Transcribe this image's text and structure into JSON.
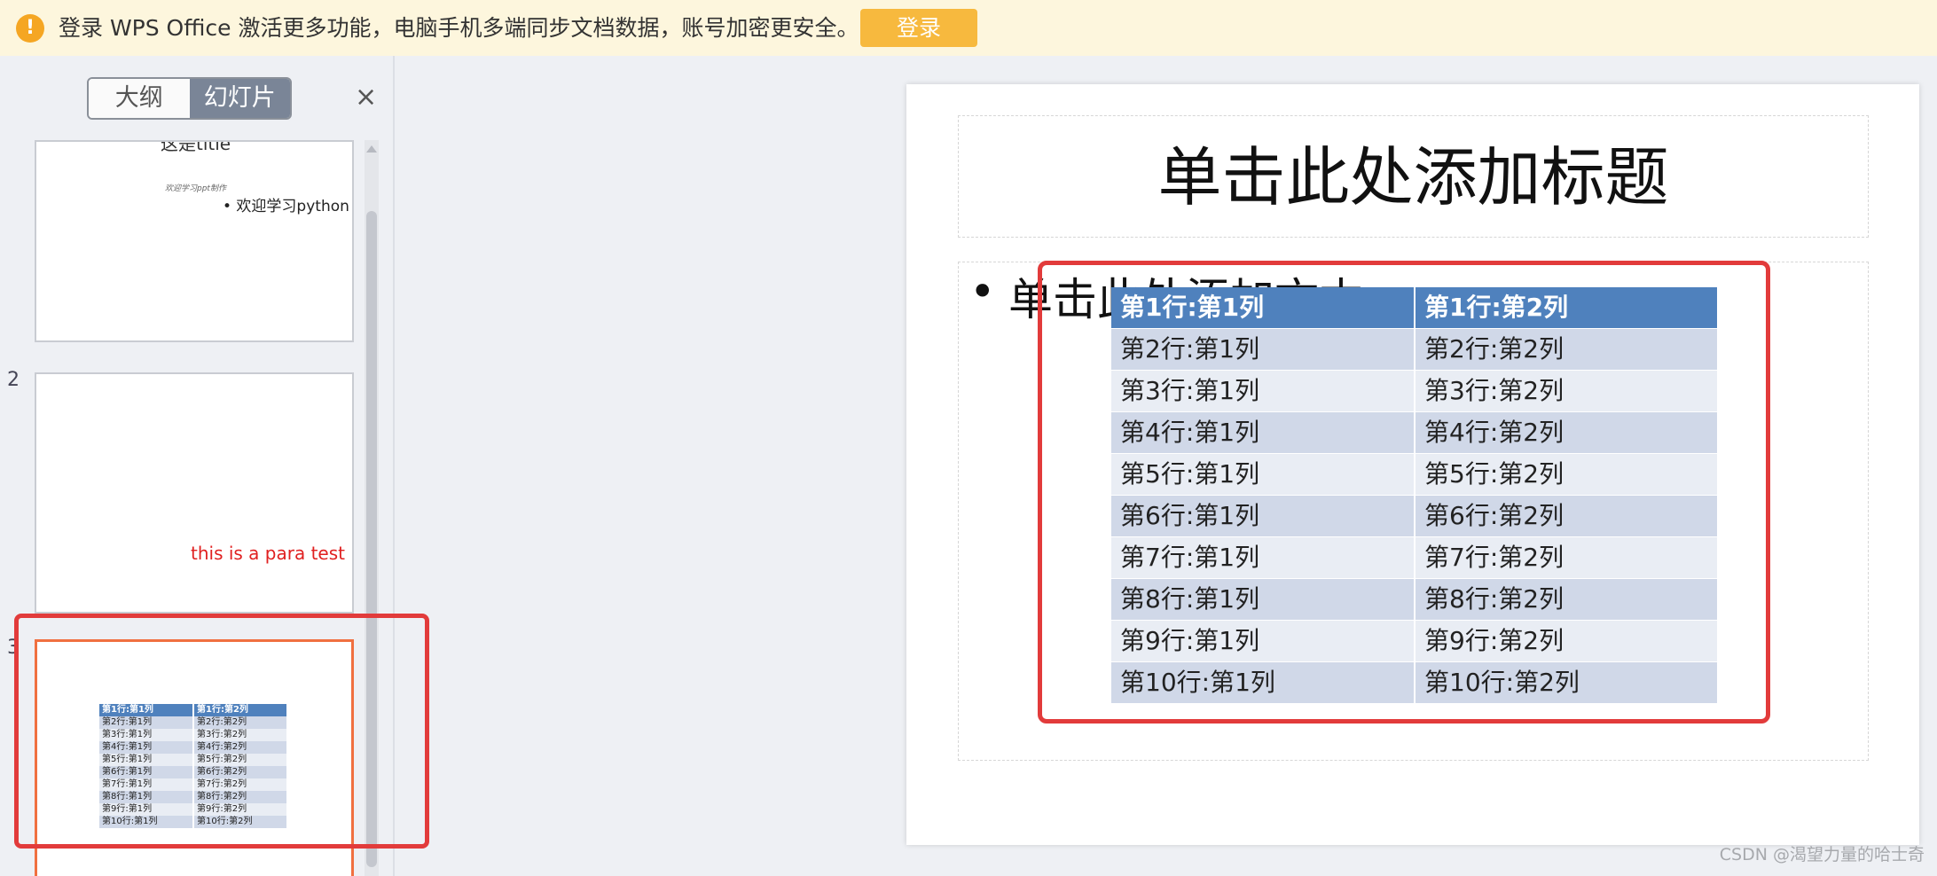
{
  "banner": {
    "icon": "warning-icon",
    "text": "登录 WPS Office 激活更多功能，电脑手机多端同步文档数据，账号加密更安全。",
    "login_label": "登录"
  },
  "sidebar": {
    "tabs": [
      "大纲",
      "幻灯片"
    ],
    "active_tab": "幻灯片",
    "close_icon": "close-icon",
    "thumbnails": [
      {
        "number": "",
        "title": "这是title",
        "small_text": "欢迎学习ppt制作",
        "bullet": "• 欢迎学习python"
      },
      {
        "number": "2",
        "para": "this is a para test"
      },
      {
        "number": "3",
        "rows": [
          [
            "第1行:第1列",
            "第1行:第2列"
          ],
          [
            "第2行:第1列",
            "第2行:第2列"
          ],
          [
            "第3行:第1列",
            "第3行:第2列"
          ],
          [
            "第4行:第1列",
            "第4行:第2列"
          ],
          [
            "第5行:第1列",
            "第5行:第2列"
          ],
          [
            "第6行:第1列",
            "第6行:第2列"
          ],
          [
            "第7行:第1列",
            "第7行:第2列"
          ],
          [
            "第8行:第1列",
            "第8行:第2列"
          ],
          [
            "第9行:第1列",
            "第9行:第2列"
          ],
          [
            "第10行:第1列",
            "第10行:第2列"
          ]
        ]
      }
    ]
  },
  "slide": {
    "title": "单击此处添加标题",
    "bullet": "•",
    "body_text": "单击此处添加文本",
    "table": [
      [
        "第1行:第1列",
        "第1行:第2列"
      ],
      [
        "第2行:第1列",
        "第2行:第2列"
      ],
      [
        "第3行:第1列",
        "第3行:第2列"
      ],
      [
        "第4行:第1列",
        "第4行:第2列"
      ],
      [
        "第5行:第1列",
        "第5行:第2列"
      ],
      [
        "第6行:第1列",
        "第6行:第2列"
      ],
      [
        "第7行:第1列",
        "第7行:第2列"
      ],
      [
        "第8行:第1列",
        "第8行:第2列"
      ],
      [
        "第9行:第1列",
        "第9行:第2列"
      ],
      [
        "第10行:第1列",
        "第10行:第2列"
      ]
    ]
  },
  "watermark": "CSDN @渴望力量的哈士奇",
  "colors": {
    "header_row": "#4f81bd",
    "row_even": "#d0d8e8",
    "row_odd": "#e9edf4",
    "annotation": "#e23b3b",
    "login_button": "#f7b93e"
  }
}
